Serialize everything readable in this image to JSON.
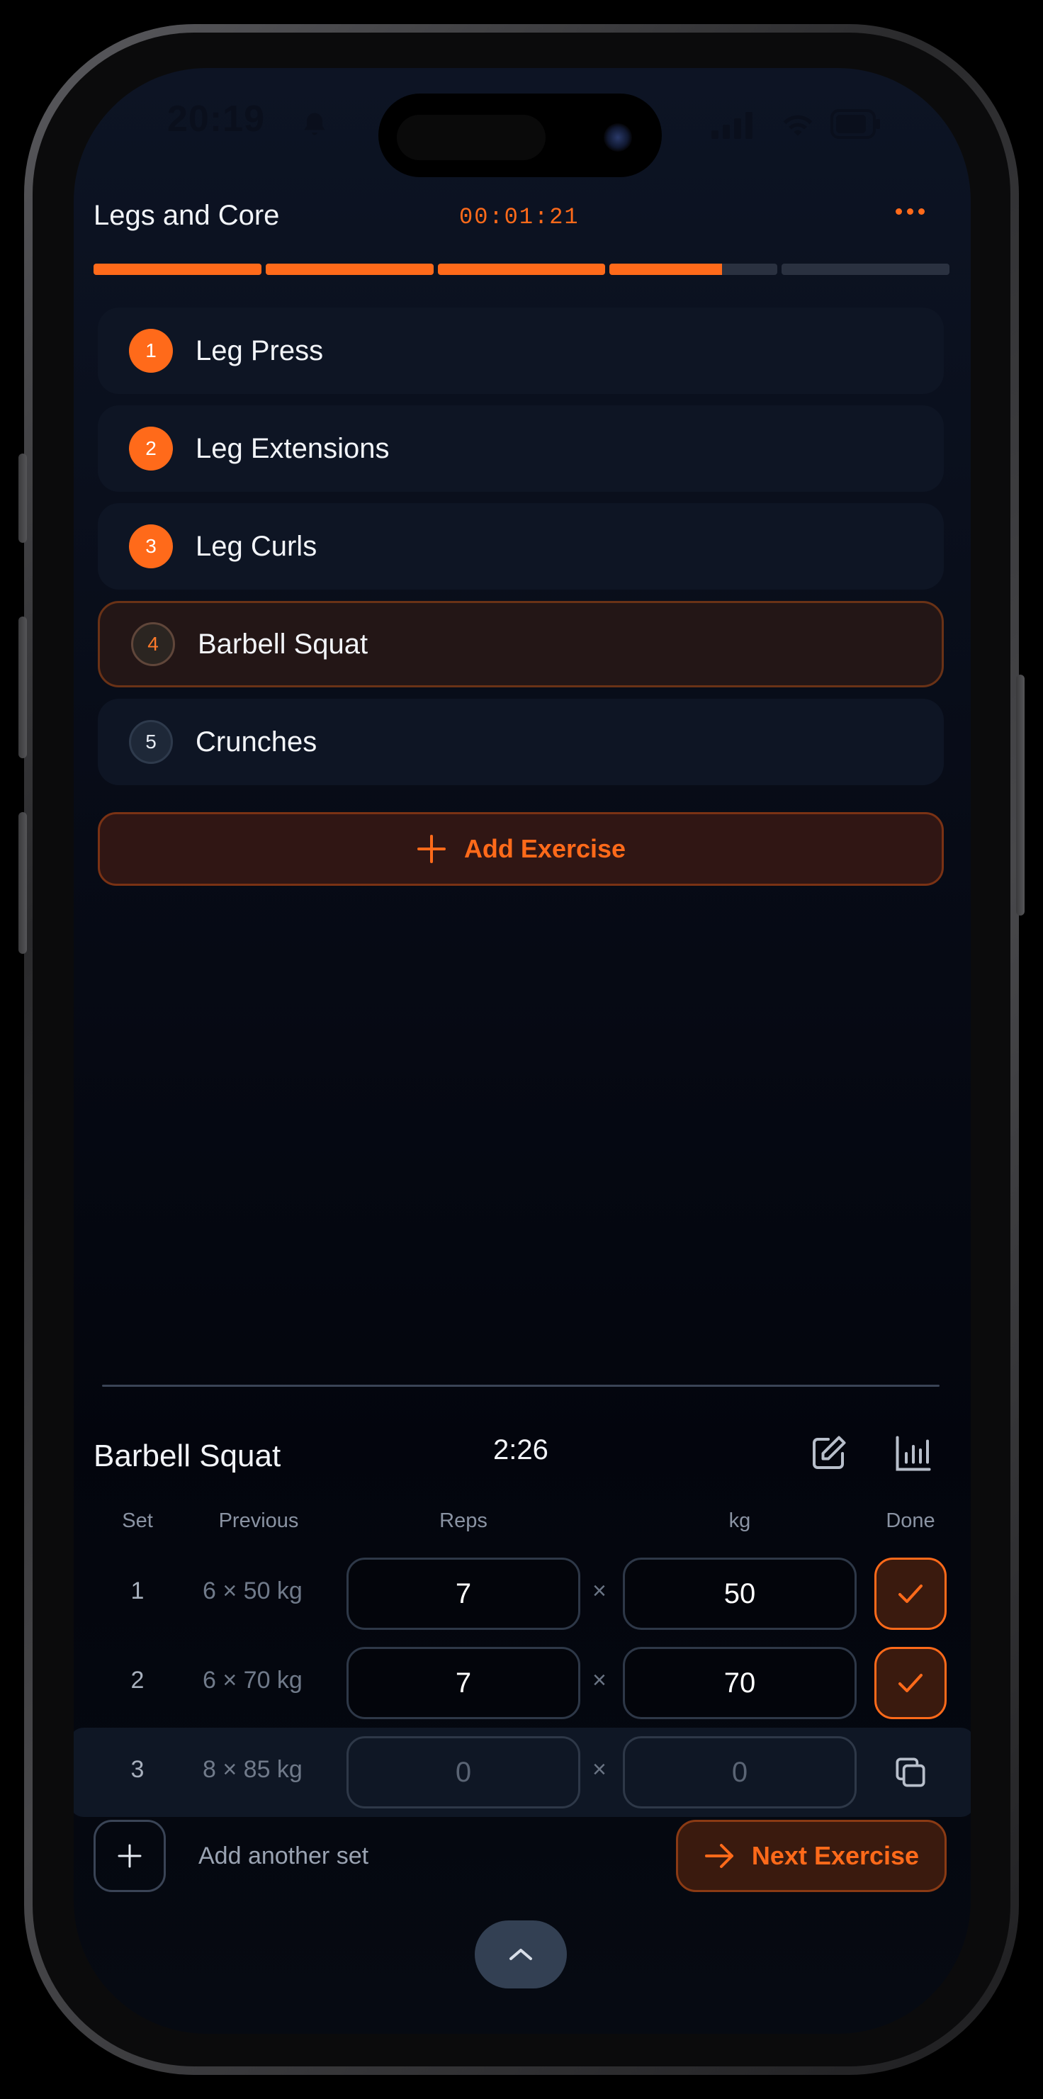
{
  "status_bar": {
    "time": "20:19"
  },
  "workout": {
    "title": "Legs and Core",
    "timer": "00:01:21",
    "progress_segments": [
      1,
      1,
      1,
      0.67,
      0
    ]
  },
  "exercises": [
    {
      "index": "1",
      "name": "Leg Press",
      "state": "done"
    },
    {
      "index": "2",
      "name": "Leg Extensions",
      "state": "done"
    },
    {
      "index": "3",
      "name": "Leg Curls",
      "state": "done"
    },
    {
      "index": "4",
      "name": "Barbell Squat",
      "state": "current"
    },
    {
      "index": "5",
      "name": "Crunches",
      "state": "pending"
    }
  ],
  "add_exercise_label": "Add Exercise",
  "current_exercise": {
    "title": "Barbell Squat",
    "rest_timer": "2:26",
    "columns": {
      "set": "Set",
      "previous": "Previous",
      "reps": "Reps",
      "kg": "kg",
      "done": "Done"
    },
    "sets": [
      {
        "set": "1",
        "previous": "6 × 50 kg",
        "reps": "7",
        "kg": "50",
        "done": true
      },
      {
        "set": "2",
        "previous": "6 × 70 kg",
        "reps": "7",
        "kg": "70",
        "done": true
      },
      {
        "set": "3",
        "previous": "8 × 85 kg",
        "reps": "0",
        "kg": "0",
        "done": false
      }
    ],
    "times_symbol": "×",
    "add_set_label": "Add another set",
    "next_label": "Next Exercise"
  },
  "accent_color": "#ff6a1a"
}
